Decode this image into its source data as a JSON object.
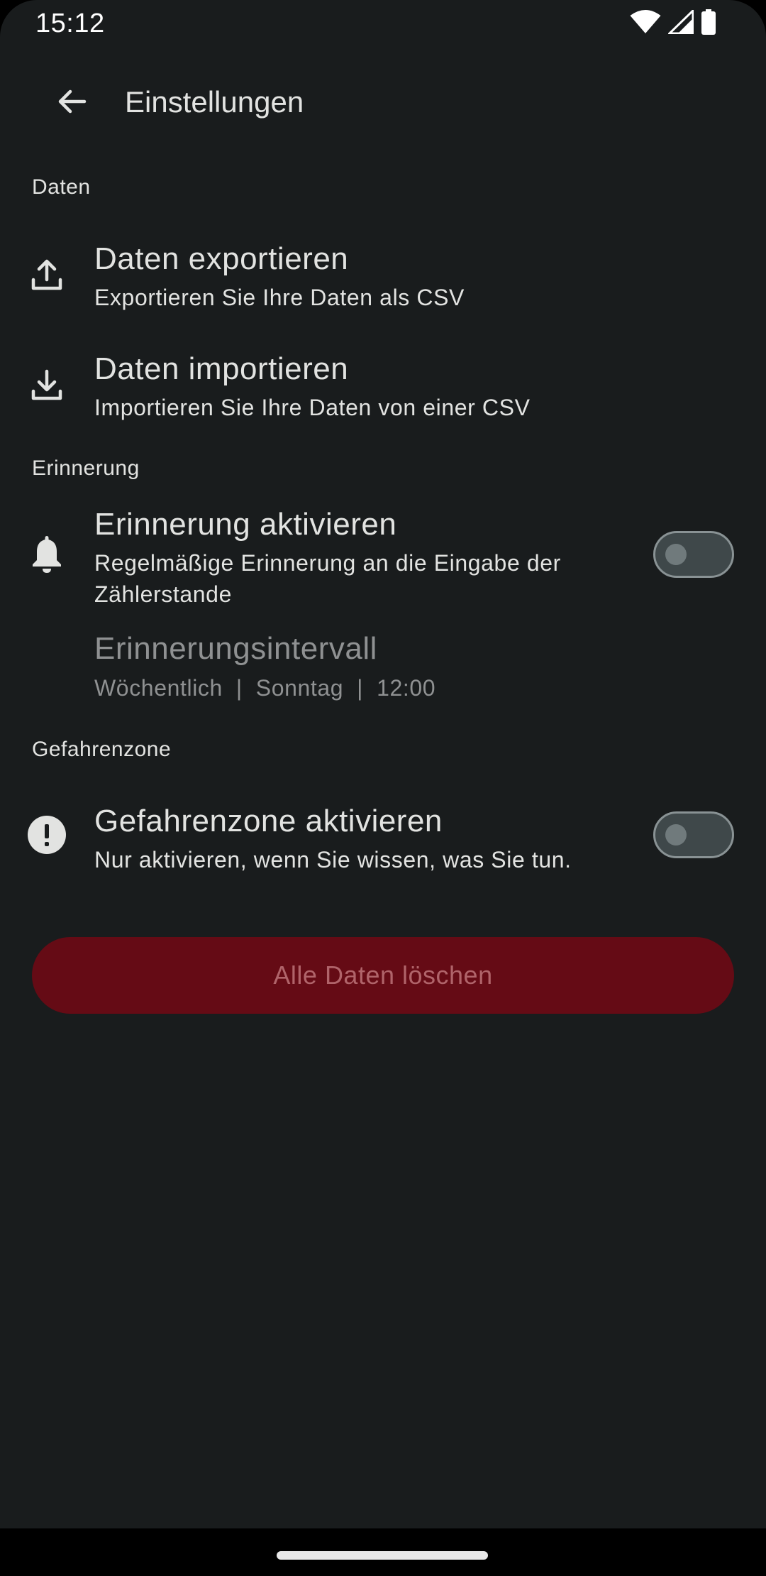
{
  "status_bar": {
    "time": "15:12",
    "icons": [
      "wifi-icon",
      "signal-icon",
      "battery-icon"
    ]
  },
  "app_bar": {
    "back_icon": "arrow-back-icon",
    "title": "Einstellungen"
  },
  "sections": {
    "data": {
      "header": "Daten",
      "export": {
        "icon": "upload-icon",
        "title": "Daten exportieren",
        "subtitle": "Exportieren Sie Ihre Daten als CSV"
      },
      "import": {
        "icon": "download-icon",
        "title": "Daten importieren",
        "subtitle": "Importieren Sie Ihre Daten von einer CSV"
      }
    },
    "reminder": {
      "header": "Erinnerung",
      "enable": {
        "icon": "bell-icon",
        "title": "Erinnerung aktivieren",
        "subtitle": "Regelmäßige Erinnerung an die Eingabe der Zählerstande",
        "enabled": false
      },
      "interval": {
        "title": "Erinnerungsintervall",
        "subtitle": "Wöchentlich  |  Sonntag  |  12:00",
        "disabled": true
      }
    },
    "danger": {
      "header": "Gefahrenzone",
      "enable": {
        "icon": "exclamation-circle-icon",
        "title": "Gefahrenzone aktivieren",
        "subtitle": "Nur aktivieren, wenn Sie wissen, was Sie tun.",
        "enabled": false
      },
      "delete_button": {
        "label": "Alle Daten löschen",
        "disabled": true
      }
    }
  },
  "colors": {
    "background": "#191c1d",
    "text": "#e2e3e1",
    "disabled_text": "#8f9192",
    "danger_button": "#650b15",
    "danger_button_text": "#b0646a",
    "switch_track": "#3f484a",
    "switch_outline": "#899294"
  }
}
